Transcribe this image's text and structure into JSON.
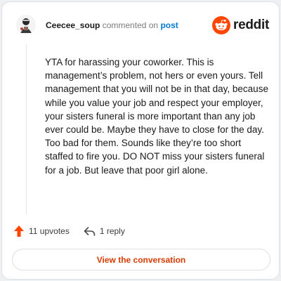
{
  "header": {
    "username": "Ceecee_soup",
    "action_text": "commented on",
    "link_text": "post",
    "logo_text": "reddit"
  },
  "comment": {
    "body": "YTA for harassing your coworker. This is management’s problem, not hers or even yours. Tell management that you will not be in that day, because while you value your job and respect your employer, your sisters funeral is more important than any job ever could be. Maybe they have to close for the day. Too bad for them. Sounds like they’re too short staffed to fire you. DO NOT miss your sisters funeral for a job. But leave that poor girl alone."
  },
  "actions": {
    "upvotes_label": "11 upvotes",
    "replies_label": "1 reply"
  },
  "cta": {
    "label": "View the conversation"
  },
  "icons": {
    "upvote": "upvote-arrow-icon",
    "reply": "reply-arrow-icon",
    "logo": "reddit-snoo-icon"
  },
  "colors": {
    "brand_orange": "#ff4500",
    "link_blue": "#0079d3",
    "cta_text": "#d93a00"
  }
}
